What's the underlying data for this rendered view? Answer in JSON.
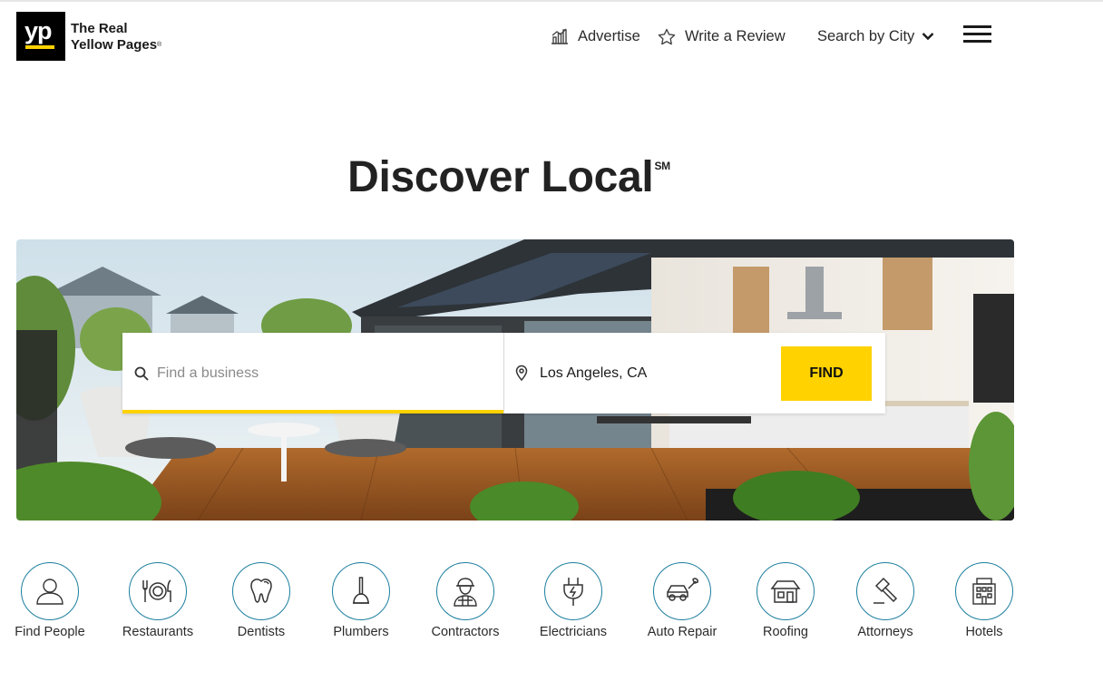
{
  "header": {
    "logo_text": "yp",
    "brand_line1": "The Real",
    "brand_line2": "Yellow Pages",
    "brand_reg": "®",
    "nav": {
      "advertise": "Advertise",
      "write_review": "Write a Review",
      "search_by_city": "Search by City"
    },
    "icons": [
      "chart-icon",
      "star-icon",
      "chevron-down-icon",
      "menu-icon"
    ]
  },
  "hero": {
    "headline": "Discover Local",
    "headline_mark": "SM"
  },
  "search": {
    "business_placeholder": "Find a business",
    "business_value": "",
    "location_value": "Los Angeles, CA",
    "find_label": "FIND",
    "accent_color": "#ffd200"
  },
  "categories": [
    {
      "label": "Find People",
      "icon": "person-icon"
    },
    {
      "label": "Restaurants",
      "icon": "utensils-icon"
    },
    {
      "label": "Dentists",
      "icon": "tooth-icon"
    },
    {
      "label": "Plumbers",
      "icon": "plunger-icon"
    },
    {
      "label": "Contractors",
      "icon": "worker-icon"
    },
    {
      "label": "Electricians",
      "icon": "plug-icon"
    },
    {
      "label": "Auto Repair",
      "icon": "car-wrench-icon"
    },
    {
      "label": "Roofing",
      "icon": "house-icon"
    },
    {
      "label": "Attorneys",
      "icon": "gavel-icon"
    },
    {
      "label": "Hotels",
      "icon": "hotel-icon"
    }
  ],
  "colors": {
    "brand_yellow": "#ffd200",
    "category_ring": "#1d7f9f",
    "logo_bg": "#000000"
  }
}
